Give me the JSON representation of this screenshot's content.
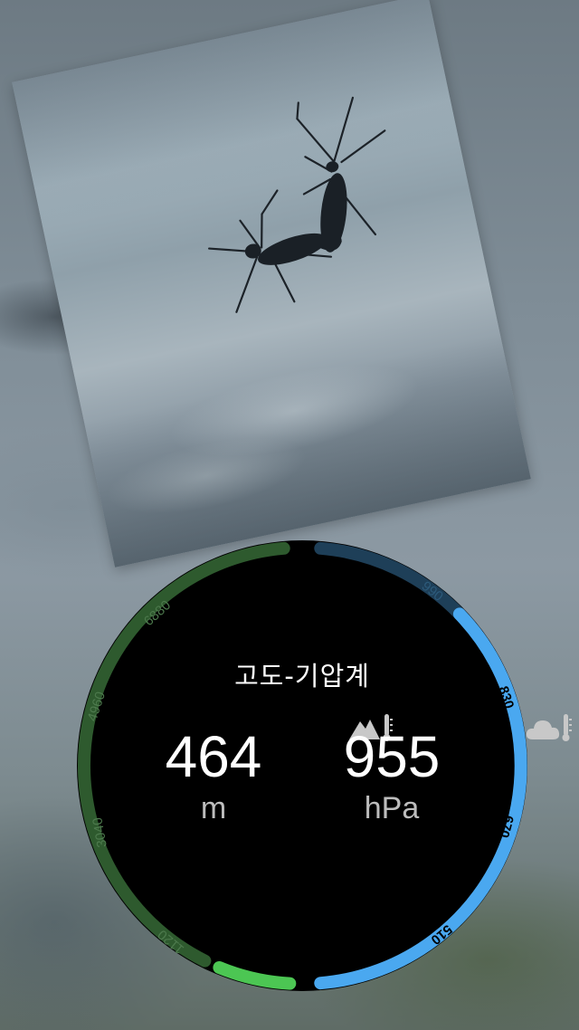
{
  "photo": {
    "subject": "insects-on-glass"
  },
  "widget": {
    "title": "고도-기압계",
    "altitude": {
      "icon": "mountain-thermometer-icon",
      "value": "464",
      "unit": "m",
      "scale_labels": [
        "6880",
        "4960",
        "3040",
        "1120"
      ],
      "level_color": "#4cc653",
      "track_color": "#2e5a2e"
    },
    "pressure": {
      "icon": "cloud-thermometer-icon",
      "value": "955",
      "unit": "hPa",
      "scale_labels": [
        "990",
        "830",
        "670",
        "510"
      ],
      "level_color": "#4aa8f0",
      "track_color": "#1e3f58"
    }
  }
}
